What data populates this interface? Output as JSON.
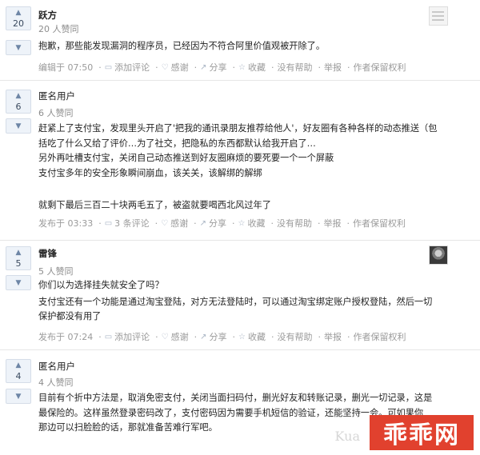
{
  "answers": [
    {
      "votes": "20",
      "author": "跃方",
      "agree": "20 人赞同",
      "lines": [
        "抱歉，那些能发现漏洞的程序员，已经因为不符合阿里价值观被开除了。"
      ],
      "meta": {
        "time": "编辑于 07:50",
        "comment": "添加评论",
        "thanks": "感谢",
        "share": "分享",
        "collect": "收藏",
        "nohelp": "没有帮助",
        "report": "举报",
        "copyright": "作者保留权利"
      }
    },
    {
      "votes": "6",
      "author": "匿名用户",
      "agree": "6 人赞同",
      "lines": [
        "赶紧上了支付宝，发现里头开启了'把我的通讯录朋友推荐给他人'，好友圈有各种各样的动态推送（包",
        "括吃了什么又给了评价…为了社交，把隐私的东西都默认给我开启了…",
        "另外再吐槽支付宝，关闭自己动态推送到好友圈麻烦的要死要一个一个屏蔽",
        "支付宝多年的安全形象瞬间崩血，该关关，该解绑的解绑",
        "",
        "就剩下最后三百二十块两毛五了，被盗就要喝西北风过年了"
      ],
      "meta": {
        "time": "发布于 03:33",
        "comment": "3 条评论",
        "thanks": "感谢",
        "share": "分享",
        "collect": "收藏",
        "nohelp": "没有帮助",
        "report": "举报",
        "copyright": "作者保留权利"
      }
    },
    {
      "votes": "5",
      "author": "雷锋",
      "agree": "5 人赞同",
      "lines": [
        "你们以为选择挂失就安全了吗？",
        "支付宝还有一个功能是通过淘宝登陆，对方无法登陆时，可以通过淘宝绑定账户授权登陆，然后一切",
        "保护都没有用了"
      ],
      "meta": {
        "time": "发布于 07:24",
        "comment": "添加评论",
        "thanks": "感谢",
        "share": "分享",
        "collect": "收藏",
        "nohelp": "没有帮助",
        "report": "举报",
        "copyright": "作者保留权利"
      }
    },
    {
      "votes": "4",
      "author": "匿名用户",
      "agree": "4 人赞同",
      "lines": [
        "目前有个折中方法是，取消免密支付，关闭当面扫码付，删光好友和转账记录，删光一切记录，这是",
        "最保险的。这样虽然登录密码改了，支付密码因为需要手机短信的验证，还能坚持一会。可如果你",
        "那边可以扫脸脸的话，那就准备苦难行军吧。"
      ]
    }
  ],
  "watermark": {
    "logo": "乖乖网",
    "faded": "Kua"
  }
}
